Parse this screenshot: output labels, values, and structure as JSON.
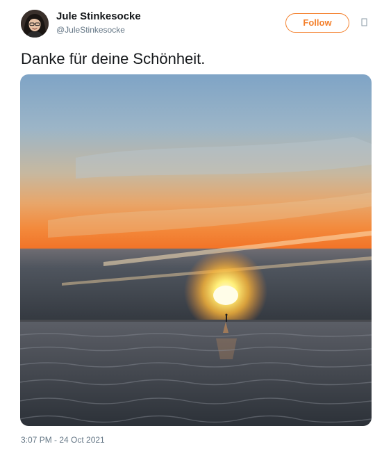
{
  "user": {
    "display_name": "Jule Stinkesocke",
    "screen_name": "@JuleStinkesocke"
  },
  "actions": {
    "follow_label": "Follow",
    "more_icon": "chevron-down-icon"
  },
  "tweet": {
    "text": "Danke für deine Schönheit.",
    "timestamp": "3:07 PM - 24 Oct 2021"
  },
  "colors": {
    "accent": "#f4802c",
    "text": "#14171a",
    "secondary_text": "#657786"
  }
}
